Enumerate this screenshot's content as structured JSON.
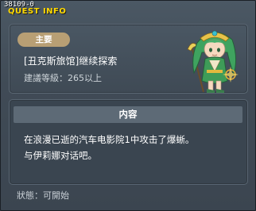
{
  "window": {
    "id_label": "38109-0",
    "title": "QUEST INFO"
  },
  "quest": {
    "badge": "主要",
    "name": "[丑克斯旅馆]继续探索",
    "level_requirement": "建議等級：265以上",
    "portrait_icon": "npc-portrait-icon"
  },
  "content": {
    "header": "内容",
    "lines": [
      "在浪漫已逝的汽车电影院1中攻击了爆蜥。",
      "与伊莉娜对话吧。"
    ]
  },
  "status": {
    "text": "狀態：可開始"
  },
  "colors": {
    "title": "#ffd900",
    "badge": "#b89f74",
    "header_bar": "#5d6a76",
    "background": "#3a4550"
  }
}
